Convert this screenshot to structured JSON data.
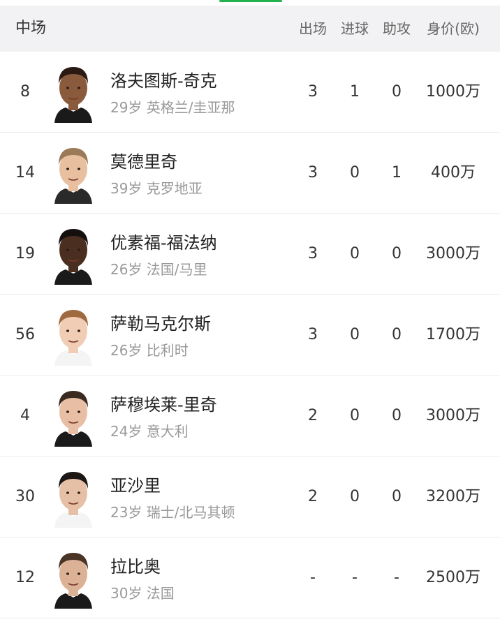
{
  "header": {
    "section_title": "中场",
    "columns": {
      "apps": "出场",
      "goals": "进球",
      "assists": "助攻",
      "value": "身价(欧)"
    }
  },
  "players": [
    {
      "number": "8",
      "name": "洛夫图斯-奇克",
      "info": "29岁 英格兰/圭亚那",
      "apps": "3",
      "goals": "1",
      "assists": "0",
      "value": "1000万",
      "skin": "#8a5a3c",
      "hair": "#2a1a12",
      "shirt": "#1a1a1a"
    },
    {
      "number": "14",
      "name": "莫德里奇",
      "info": "39岁 克罗地亚",
      "apps": "3",
      "goals": "0",
      "assists": "1",
      "value": "400万",
      "skin": "#e8c0a0",
      "hair": "#9a7a58",
      "shirt": "#2a2a2a"
    },
    {
      "number": "19",
      "name": "优素福-福法纳",
      "info": "26岁 法国/马里",
      "apps": "3",
      "goals": "0",
      "assists": "0",
      "value": "3000万",
      "skin": "#4a2e20",
      "hair": "#141010",
      "shirt": "#1a1a1a"
    },
    {
      "number": "56",
      "name": "萨勒马克尔斯",
      "info": "26岁 比利时",
      "apps": "3",
      "goals": "0",
      "assists": "0",
      "value": "1700万",
      "skin": "#f0cdb4",
      "hair": "#a06a40",
      "shirt": "#f4f4f4"
    },
    {
      "number": "4",
      "name": "萨穆埃莱-里奇",
      "info": "24岁 意大利",
      "apps": "2",
      "goals": "0",
      "assists": "0",
      "value": "3000万",
      "skin": "#e8bfa4",
      "hair": "#3a2a20",
      "shirt": "#1a1a1a"
    },
    {
      "number": "30",
      "name": "亚沙里",
      "info": "23岁 瑞士/北马其顿",
      "apps": "2",
      "goals": "0",
      "assists": "0",
      "value": "3200万",
      "skin": "#e6c0a6",
      "hair": "#1c1614",
      "shirt": "#f4f4f4"
    },
    {
      "number": "12",
      "name": "拉比奥",
      "info": "30岁 法国",
      "apps": "-",
      "goals": "-",
      "assists": "-",
      "value": "2500万",
      "skin": "#dcb296",
      "hair": "#4a3426",
      "shirt": "#1a1a1a"
    }
  ]
}
